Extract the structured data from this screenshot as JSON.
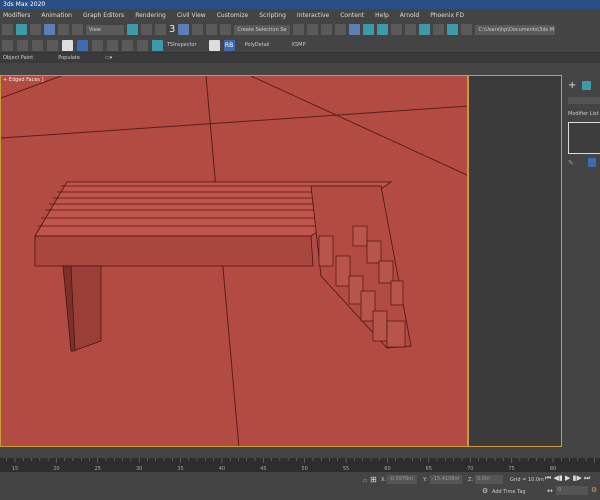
{
  "title": "3ds Max 2020",
  "menu": [
    "Modifiers",
    "Animation",
    "Graph Editors",
    "Rendering",
    "Civil View",
    "Customize",
    "Scripting",
    "Interactive",
    "Content",
    "Help",
    "Arnold",
    "Phoenix FD"
  ],
  "toolbar": {
    "view_dropdown": "View",
    "selection_set": "Create Selection Se",
    "path": "C:\\Users\\hp\\Documents\\3ds M",
    "snap_label": "3"
  },
  "toolbar2": {
    "tsinspector": "TSInspector",
    "rb": "RB",
    "polydetail": "PolyDetail",
    "xsmp": "XSMP"
  },
  "ribbon": {
    "object_paint": "Object Paint",
    "populate": "Populate"
  },
  "viewport": {
    "label": "+ Edged Faces ]",
    "color": "#b24b42"
  },
  "command_panel": {
    "modifier_list": "Modifier List"
  },
  "timeline": {
    "ticks": [
      "15",
      "20",
      "25",
      "30",
      "35",
      "40",
      "45",
      "50",
      "55",
      "60",
      "65",
      "70",
      "75",
      "80"
    ]
  },
  "status": {
    "x_label": "X:",
    "x": "-0.5976m",
    "y_label": "Y:",
    "y": "-15.4108m",
    "z_label": "Z:",
    "z": "0.0m",
    "grid": "Grid = 10.0m",
    "add_time_tag": "Add Time Tag",
    "frame": "0"
  }
}
